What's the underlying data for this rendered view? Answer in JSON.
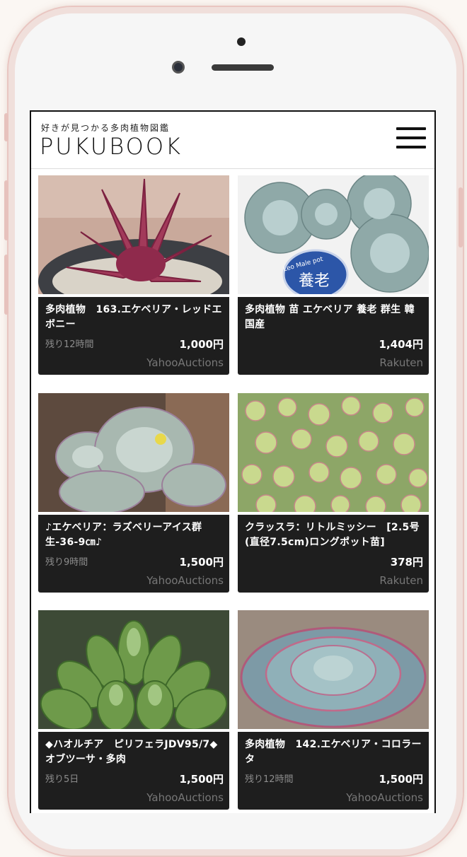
{
  "site": {
    "tagline": "好きが見つかる多肉植物図鑑",
    "logo": "PUKUBOOK",
    "menu_icon": "hamburger-menu-icon"
  },
  "items": [
    {
      "title": "多肉植物　163.エケベリア・レッドエボニー",
      "remaining": "残り12時間",
      "price": "1,000円",
      "source": "YahooAuctions"
    },
    {
      "title": "多肉植物 苗 エケベリア 養老 群生 韓国産",
      "remaining": "",
      "price": "1,404円",
      "source": "Rakuten",
      "image_label": "養老",
      "image_tag": "Leo Male pot"
    },
    {
      "title": "♪エケベリア：ラズベリーアイス群生-36-9㎝♪",
      "remaining": "残り9時間",
      "price": "1,500円",
      "source": "YahooAuctions"
    },
    {
      "title": "クラッスラ：リトルミッシー　[2.5号(直径7.5cm)ロングポット苗]",
      "remaining": "",
      "price": "378円",
      "source": "Rakuten"
    },
    {
      "title": "◆ハオルチア　ピリフェラJDV95/7◆オブツーサ・多肉",
      "remaining": "残り5日",
      "price": "1,500円",
      "source": "YahooAuctions"
    },
    {
      "title": "多肉植物　142.エケベリア・コロラータ",
      "remaining": "残り12時間",
      "price": "1,500円",
      "source": "YahooAuctions"
    }
  ]
}
